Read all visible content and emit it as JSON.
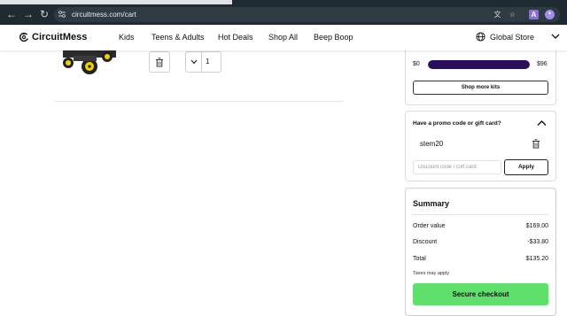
{
  "browser": {
    "url": "circuitmess.com/cart",
    "extensions": [
      "translate-icon",
      "star-icon",
      "A",
      "extension-purple-icon",
      "puzzle-icon"
    ],
    "ext_a_label": "A"
  },
  "header": {
    "logo_text": "CircuitMess",
    "nav": [
      "Kids",
      "Teens & Adults",
      "Hot Deals",
      "Shop All",
      "Beep Boop"
    ],
    "store_label": "Global Store"
  },
  "cart_item": {
    "quantity": "1"
  },
  "shipping": {
    "min_label": "$0",
    "max_label": "$96",
    "progress_fraction": 1.0,
    "shop_more_label": "Shop more kits"
  },
  "promo": {
    "title": "Have a promo code or gift card?",
    "applied_code": "stem20",
    "input_placeholder": "Discount code / Gift card",
    "apply_label": "Apply"
  },
  "summary": {
    "title": "Summary",
    "order_value_label": "Order value",
    "order_value": "$169.00",
    "discount_label": "Discount",
    "discount": "-$33.80",
    "total_label": "Total",
    "total": "$135.20",
    "tax_note": "Taxes may apply",
    "checkout_label": "Secure checkout"
  },
  "colors": {
    "checkout_green": "#5fe06c",
    "progress_purple": "#2a0e5c",
    "browser_dark": "#202b31"
  }
}
